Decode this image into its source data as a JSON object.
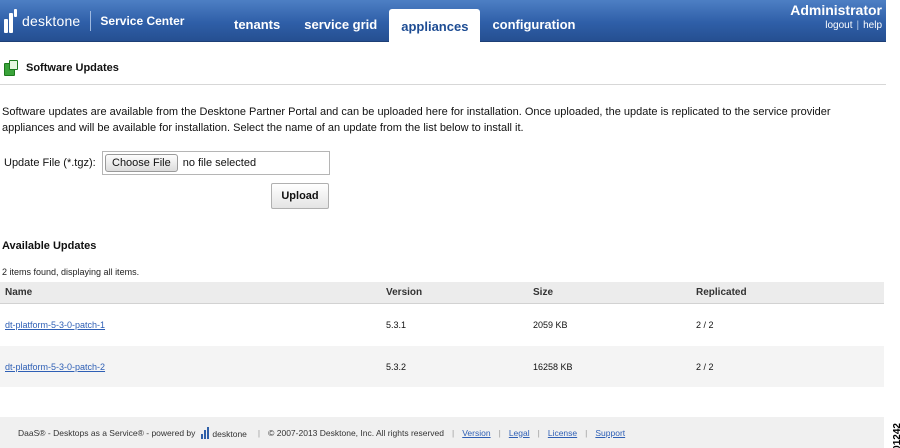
{
  "header": {
    "brand": "desktone",
    "product": "Service Center",
    "tabs": [
      {
        "label": "tenants",
        "active": false
      },
      {
        "label": "service grid",
        "active": false
      },
      {
        "label": "appliances",
        "active": true
      },
      {
        "label": "configuration",
        "active": false
      }
    ],
    "user": "Administrator",
    "logout_label": "logout",
    "help_label": "help",
    "link_separator": "|"
  },
  "section": {
    "title": "Software Updates",
    "icon": "package-update-icon"
  },
  "intro": "Software updates are available from the Desktone Partner Portal and can be uploaded here for installation. Once uploaded, the update is replicated to the service provider appliances and will be available for installation. Select the name of an update from the list below to install it.",
  "upload": {
    "label": "Update File (*.tgz):",
    "choose_label": "Choose File",
    "file_status": "no file selected",
    "upload_label": "Upload"
  },
  "updates": {
    "title": "Available Updates",
    "count_text": "2 items found, displaying all items.",
    "columns": [
      "Name",
      "Version",
      "Size",
      "Replicated"
    ],
    "rows": [
      {
        "name": "dt-platform-5-3-0-patch-1",
        "version": "5.3.1",
        "size": "2059 KB",
        "replicated": "2 / 2"
      },
      {
        "name": "dt-platform-5-3-0-patch-2",
        "version": "5.3.2",
        "size": "16258 KB",
        "replicated": "2 / 2"
      }
    ]
  },
  "footer": {
    "powered_text": "DaaS® - Desktops as a Service® - powered by",
    "logo_text": "desktone",
    "copyright": "© 2007-2013 Desktone, Inc. All rights reserved",
    "links": [
      "Version",
      "Legal",
      "License",
      "Support"
    ]
  },
  "figure_id": "301242",
  "colors": {
    "header_blue": "#2f5fa8",
    "active_tab_text": "#1d4c93",
    "link_blue": "#2e5fb5",
    "icon_green": "#3aa33a"
  }
}
